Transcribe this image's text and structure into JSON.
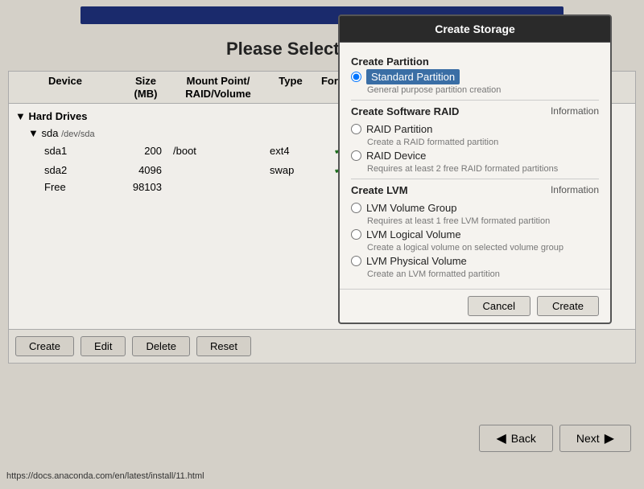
{
  "topBar": {},
  "page": {
    "title": "Please Select A Device"
  },
  "table": {
    "columns": {
      "device": "Device",
      "size": "Size\n(MB)",
      "mount": "Mount Point/\nRAID/Volume",
      "type": "Type",
      "format": "Format"
    },
    "groups": [
      {
        "label": "Hard Drives",
        "children": [
          {
            "label": "sda",
            "sublabel": "/dev/sda",
            "children": [
              {
                "name": "sda1",
                "size": "200",
                "mount": "/boot",
                "type": "ext4",
                "format": true
              },
              {
                "name": "sda2",
                "size": "4096",
                "mount": "",
                "type": "swap",
                "format": true
              },
              {
                "name": "Free",
                "size": "98103",
                "mount": "",
                "type": "",
                "format": false
              }
            ]
          }
        ]
      }
    ]
  },
  "toolbar": {
    "create": "Create",
    "edit": "Edit",
    "delete": "Delete",
    "reset": "Reset"
  },
  "dialog": {
    "title": "Create Storage",
    "sections": {
      "createPartition": {
        "heading": "Create Partition",
        "options": [
          {
            "id": "standard",
            "label": "Standard Partition",
            "desc": "General purpose partition creation",
            "selected": true
          }
        ]
      },
      "createSoftwareRAID": {
        "heading": "Create Software RAID",
        "info": "Information",
        "options": [
          {
            "id": "raidPartition",
            "label": "RAID Partition",
            "desc": "Create a RAID formatted partition",
            "selected": false
          },
          {
            "id": "raidDevice",
            "label": "RAID Device",
            "desc": "Requires at least 2 free RAID formated partitions",
            "selected": false
          }
        ]
      },
      "createLVM": {
        "heading": "Create LVM",
        "info": "Information",
        "options": [
          {
            "id": "lvmVolumeGroup",
            "label": "LVM Volume Group",
            "desc": "Requires at least 1 free LVM formated partition",
            "selected": false
          },
          {
            "id": "lvmLogicalVolume",
            "label": "LVM Logical Volume",
            "desc": "Create a logical volume on selected volume group",
            "selected": false
          },
          {
            "id": "lvmPhysicalVolume",
            "label": "LVM Physical Volume",
            "desc": "Create an LVM formatted partition",
            "selected": false
          }
        ]
      }
    },
    "buttons": {
      "cancel": "Cancel",
      "create": "Create"
    }
  },
  "nav": {
    "back": "Back",
    "next": "Next"
  },
  "statusBar": {
    "url": "https://docs.anaconda.com/en/latest/install/11.html"
  }
}
